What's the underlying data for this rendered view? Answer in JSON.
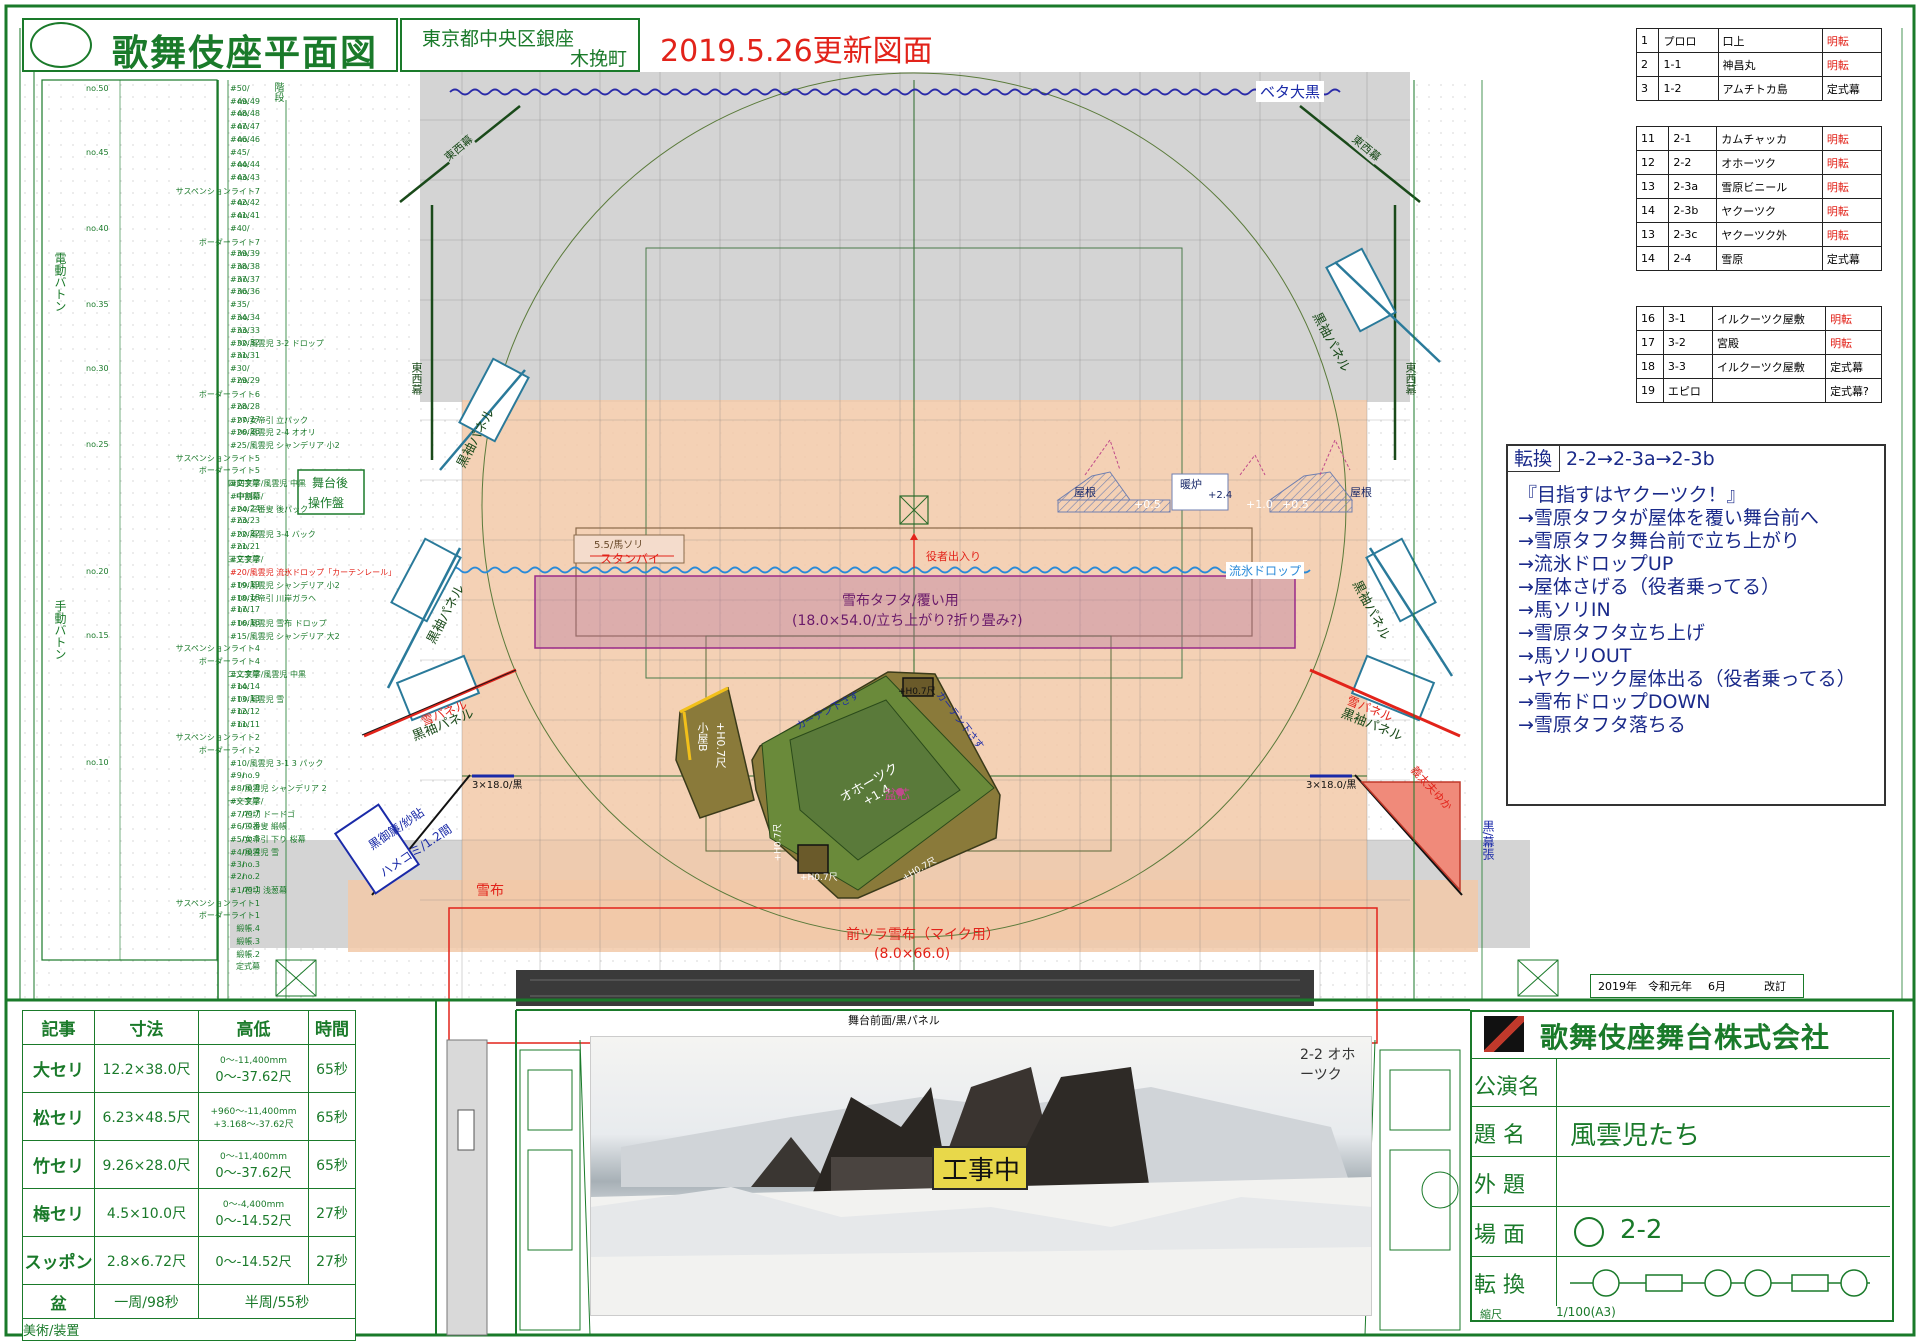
{
  "header": {
    "title": "歌舞伎座平面図",
    "location_line1": "東京都中央区銀座",
    "location_line2": "木挽町",
    "update_note": "2019.5.26更新図面"
  },
  "scenes_group1": [
    {
      "no": "1",
      "code": "プロロ",
      "name": "口上",
      "transition": "明転"
    },
    {
      "no": "2",
      "code": "1-1",
      "name": "神昌丸",
      "transition": "明転"
    },
    {
      "no": "3",
      "code": "1-2",
      "name": "アムチトカ島",
      "transition": "定式幕"
    }
  ],
  "scenes_group2": [
    {
      "no": "11",
      "code": "2-1",
      "name": "カムチャッカ",
      "transition": "明転"
    },
    {
      "no": "12",
      "code": "2-2",
      "name": "オホーツク",
      "transition": "明転"
    },
    {
      "no": "13",
      "code": "2-3a",
      "name": "雪原ビニール",
      "transition": "明転"
    },
    {
      "no": "14",
      "code": "2-3b",
      "name": "ヤクーツク",
      "transition": "明転"
    },
    {
      "no": "13",
      "code": "2-3c",
      "name": "ヤクーツク外",
      "transition": "明転"
    },
    {
      "no": "14",
      "code": "2-4",
      "name": "雪原",
      "transition": "定式幕"
    }
  ],
  "scenes_group3": [
    {
      "no": "16",
      "code": "3-1",
      "name": "イルクーツク屋敷",
      "transition": "明転"
    },
    {
      "no": "17",
      "code": "3-2",
      "name": "宮殿",
      "transition": "明転"
    },
    {
      "no": "18",
      "code": "3-3",
      "name": "イルクーツク屋敷",
      "transition": "定式幕"
    },
    {
      "no": "19",
      "code": "エピロ",
      "name": "",
      "transition": "定式幕?"
    }
  ],
  "conversion": {
    "label": "転換",
    "sequence": "2-2→2-3a→2-3b",
    "lines": [
      "『目指すはヤクーツク！』",
      "→雪原タフタが屋体を覆い舞台前へ",
      "→雪原タフタ舞台前で立ち上がり",
      "→流氷ドロップUP",
      "→屋体さげる（役者乗ってる）",
      "→馬ソリIN",
      "→雪原タフタ立ち上げ",
      "→馬ソリOUT",
      "→ヤクーツク屋体出る（役者乗ってる）",
      "→雪布ドロップDOWN",
      "→雪原タフタ落ちる"
    ]
  },
  "stage_labels": {
    "beta_ookuro": "ベタ大黒",
    "tozai_maku": "東西幕",
    "kuro_soku_panel": "黒袖パネル",
    "ryuhyo_drop": "流氷ドロップ",
    "yakusha_deiri": "役者出入り",
    "basori": "5.5/馬ソリ",
    "standby": "スタンバイ",
    "yukinuno_tafuta": "雪布タフタ/覆い用",
    "yukinuno_tafuta_sub": "(18.0×54.0/立ち上がり?折り畳み?)",
    "okhotsk": "オホーツク",
    "okhotsk_h": "+1.4",
    "bonshin": "盆芯",
    "koya": "小屋B",
    "koya_h": "+H0.7尺",
    "curtain": "カーテン下さす",
    "h07": "+H0.7尺",
    "yane": "屋根",
    "danro": "暖炉",
    "danro_h": "+2.4",
    "p05": "+0.5",
    "p10": "+1.0",
    "yukinuno": "雪布",
    "maetsura": "前ツラ雪布（マイク用）",
    "maetsura_size": "(8.0×66.0)",
    "kuro_left": "3×18.0/黒",
    "kuro_right": "3×18.0/黒",
    "kuro_misu": "黒御簾/紗貼",
    "hamekomi": "ハメコミ/1.2間",
    "giday_yuka": "義太夫ゆか",
    "kuro_hanamichi": "黒/幕張",
    "butai_zenmen": "舞台前面/黒パネル",
    "ura_sousa": "舞台後",
    "ura_sousa2": "操作盤",
    "kaidan": "階段",
    "yuki_panel_left": "雪パネル",
    "yuki_panel_right": "雪パネル",
    "kouji": "工事中",
    "sketch_note": "2-2 オホーツク"
  },
  "left_labels": {
    "denki_baton": "電動バトン",
    "shudo_baton": "手動バトン",
    "rows": [
      {
        "no": "no.50",
        "label": "",
        "line": "#50/"
      },
      {
        "no": "",
        "label": "no.49",
        "line": "#49/"
      },
      {
        "no": "",
        "label": "no.48",
        "line": "#48/"
      },
      {
        "no": "",
        "label": "no.47",
        "line": "#47/"
      },
      {
        "no": "",
        "label": "no.46",
        "line": "#46/"
      },
      {
        "no": "no.45",
        "label": "",
        "line": "#45/"
      },
      {
        "no": "",
        "label": "no.44",
        "line": "#44/"
      },
      {
        "no": "",
        "label": "no.43",
        "line": "#43/"
      },
      {
        "no": "",
        "label": "サスペンションライト7",
        "line": ""
      },
      {
        "no": "",
        "label": "no.42",
        "line": "#42/"
      },
      {
        "no": "",
        "label": "no.41",
        "line": "#41/"
      },
      {
        "no": "no.40",
        "label": "",
        "line": "#40/"
      },
      {
        "no": "",
        "label": "ボーダーライト7",
        "line": ""
      },
      {
        "no": "",
        "label": "no.39",
        "line": "#39/"
      },
      {
        "no": "",
        "label": "no.38",
        "line": "#38/"
      },
      {
        "no": "",
        "label": "no.37",
        "line": "#37/"
      },
      {
        "no": "",
        "label": "no.36",
        "line": "#36/"
      },
      {
        "no": "no.35",
        "label": "",
        "line": "#35/"
      },
      {
        "no": "",
        "label": "no.34",
        "line": "#34/"
      },
      {
        "no": "",
        "label": "no.33",
        "line": "#33/"
      },
      {
        "no": "",
        "label": "no.32",
        "line": "#32/風雲児 3-2 ドロップ"
      },
      {
        "no": "",
        "label": "no.31",
        "line": "#31/"
      },
      {
        "no": "no.30",
        "label": "",
        "line": "#30/"
      },
      {
        "no": "",
        "label": "no.29",
        "line": "#29/"
      },
      {
        "no": "",
        "label": "ボーダーライト6",
        "line": ""
      },
      {
        "no": "",
        "label": "no.28",
        "line": "#28/"
      },
      {
        "no": "",
        "label": "no.27",
        "line": "#27/女帝引 立パック"
      },
      {
        "no": "",
        "label": "no.26",
        "line": "#26/風雲児 2-4 オオリ"
      },
      {
        "no": "no.25",
        "label": "",
        "line": "#25/風雲児 シャンデリア 小2"
      },
      {
        "no": "",
        "label": "サスペンションライト5",
        "line": ""
      },
      {
        "no": "",
        "label": "ボーダーライト5",
        "line": ""
      },
      {
        "no": "",
        "label": "四文字幕",
        "line": "#四文字/風雲児 中黒"
      },
      {
        "no": "",
        "label": "中割幕",
        "line": "#中割幕/"
      },
      {
        "no": "",
        "label": "no.24",
        "line": "#24/三番叟 後パック"
      },
      {
        "no": "",
        "label": "no.23",
        "line": "#23/"
      },
      {
        "no": "",
        "label": "no.22",
        "line": "#22/風雲児 3-4 バック"
      },
      {
        "no": "",
        "label": "no.21",
        "line": "#21/"
      },
      {
        "no": "",
        "label": "三文字幕",
        "line": "#三文字/"
      },
      {
        "no": "no.20",
        "label": "",
        "line": "#20/風雲児 流氷ドロップ「カーテンレール」"
      },
      {
        "no": "",
        "label": "no.19",
        "line": "#19/風雲児 シャンデリア 小2"
      },
      {
        "no": "",
        "label": "no.18",
        "line": "#18/女帝引 川岸ガラヘ"
      },
      {
        "no": "",
        "label": "no.17",
        "line": "#17/"
      },
      {
        "no": "",
        "label": "no.16",
        "line": "#16/風雲児 雪布 ドロップ"
      },
      {
        "no": "no.15",
        "label": "",
        "line": "#15/風雲児 シャンデリア 大2"
      },
      {
        "no": "",
        "label": "サスペンションライト4",
        "line": ""
      },
      {
        "no": "",
        "label": "ボーダーライト4",
        "line": ""
      },
      {
        "no": "",
        "label": "二文字幕",
        "line": "#二文字/風雲児 中黒"
      },
      {
        "no": "",
        "label": "no.14",
        "line": "#14/"
      },
      {
        "no": "",
        "label": "no.13",
        "line": "#13/風雲児 雪"
      },
      {
        "no": "",
        "label": "no.12",
        "line": "#12/"
      },
      {
        "no": "",
        "label": "no.11",
        "line": "#11/"
      },
      {
        "no": "",
        "label": "サスペンションライト2",
        "line": ""
      },
      {
        "no": "",
        "label": "ボーダーライト2",
        "line": ""
      },
      {
        "no": "no.10",
        "label": "",
        "line": "#10/風雲児 3-1 3 パック"
      },
      {
        "no": "",
        "label": "no.9",
        "line": "#9/"
      },
      {
        "no": "",
        "label": "no.8",
        "line": "#8/風雲児 シャンデリア 2"
      },
      {
        "no": "",
        "label": "一文字幕",
        "line": "#一文字/"
      },
      {
        "no": "",
        "label": "no.7",
        "line": "#7/石切 ドードゴ"
      },
      {
        "no": "",
        "label": "no.6",
        "line": "#6/三番叟 緞帳"
      },
      {
        "no": "",
        "label": "no.5",
        "line": "#5/女帝引 下り 桜幕"
      },
      {
        "no": "",
        "label": "no.4",
        "line": "#4/風雲児 雪"
      },
      {
        "no": "",
        "label": "no.3",
        "line": "#3/"
      },
      {
        "no": "",
        "label": "no.2",
        "line": "#2/"
      },
      {
        "no": "",
        "label": "no.1",
        "line": "#1/石切 浅葱幕"
      },
      {
        "no": "",
        "label": "サスペンションライト1",
        "line": ""
      },
      {
        "no": "",
        "label": "ボーダーライト1",
        "line": ""
      },
      {
        "no": "",
        "label": "緞帳.4",
        "line": ""
      },
      {
        "no": "",
        "label": "緞帳.3",
        "line": ""
      },
      {
        "no": "",
        "label": "緞帳.2",
        "line": ""
      },
      {
        "no": "",
        "label": "定式幕",
        "line": ""
      }
    ]
  },
  "bottom_table": {
    "headers": [
      "記事",
      "寸法",
      "高低",
      "時間"
    ],
    "rows": [
      {
        "name": "大セリ",
        "size": "12.2×38.0尺",
        "h1": "0〜-11,400mm",
        "h2": "0〜-37.62尺",
        "time": "65秒"
      },
      {
        "name": "松セリ",
        "size": "6.23×48.5尺",
        "h1": "+960〜-11,400mm",
        "h2": "+3.168〜-37.62尺",
        "time": "65秒"
      },
      {
        "name": "竹セリ",
        "size": "9.26×28.0尺",
        "h1": "0〜-11,400mm",
        "h2": "0〜-37.62尺",
        "time": "65秒"
      },
      {
        "name": "梅セリ",
        "size": "4.5×10.0尺",
        "h1": "0〜-4,400mm",
        "h2": "0〜-14.52尺",
        "time": "27秒"
      },
      {
        "name": "スッポン",
        "size": "2.8×6.72尺",
        "h1": "",
        "h2": "0〜-14.52尺",
        "time": "27秒"
      }
    ],
    "bon_label": "盆",
    "bon_full": "一周/98秒",
    "bon_half": "半周/55秒",
    "bijutsu": "美術/装置"
  },
  "revision": {
    "year": "2019年",
    "era": "令和元年",
    "month": "6月",
    "kaitei": "改訂"
  },
  "company": {
    "name": "歌舞伎座舞台株式会社",
    "rows": [
      {
        "label": "公演名",
        "value": ""
      },
      {
        "label": "題 名",
        "value": "風雲児たち"
      },
      {
        "label": "外 題",
        "value": ""
      },
      {
        "label": "場 面",
        "value": "2-2"
      },
      {
        "label": "転 換",
        "value": ""
      }
    ],
    "scale_label": "縮尺",
    "scale_value": "1/100(A3)"
  },
  "colors": {
    "green": "#1a7a2a",
    "red": "#e2231a",
    "stage_orange": "#f2c9a8",
    "gray": "#d4d4d4"
  }
}
